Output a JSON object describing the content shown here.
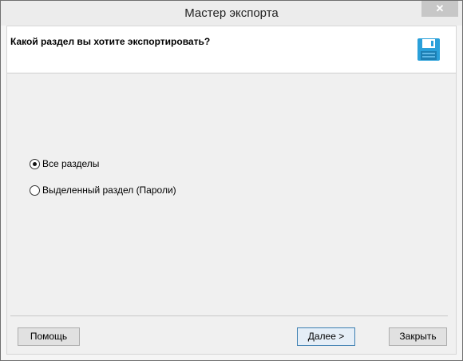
{
  "window": {
    "title": "Мастер экспорта",
    "close_glyph": "✕"
  },
  "header": {
    "question": "Какой раздел вы хотите экспортировать?",
    "icon": "floppy-disk-icon"
  },
  "options": [
    {
      "label": "Все разделы",
      "selected": true
    },
    {
      "label": "Выделенный раздел (Пароли)",
      "selected": false
    }
  ],
  "buttons": {
    "help": "Помощь",
    "next": "Далее >",
    "close": "Закрыть"
  },
  "colors": {
    "accent": "#3c7fb1",
    "floppy": "#2aa0da"
  }
}
